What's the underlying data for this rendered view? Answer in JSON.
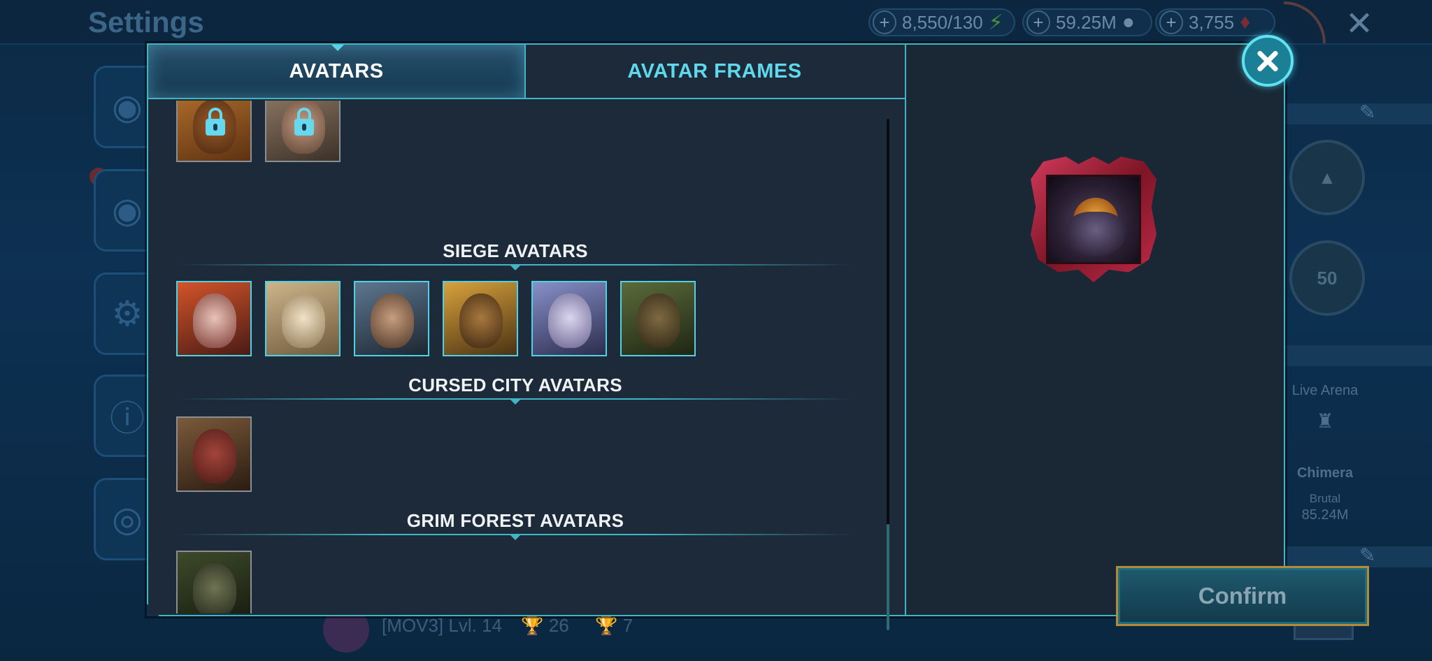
{
  "background": {
    "title": "Settings",
    "resources": [
      {
        "value": "8,550/130",
        "icon": "energy-icon"
      },
      {
        "value": "59.25M",
        "icon": "silver-icon"
      },
      {
        "value": "3,755",
        "icon": "gem-icon"
      }
    ],
    "right_panel": {
      "live_arena_label": "Live Arena",
      "clan_boss_name": "Chimera",
      "difficulty": "Brutal",
      "damage": "85.24M",
      "level_badge": "50"
    },
    "player": {
      "clan_tag": "[MOV3] Lvl. 14",
      "stat_1": "26",
      "stat_2": "7"
    }
  },
  "modal": {
    "tabs": [
      {
        "label": "AVATARS",
        "active": true
      },
      {
        "label": "AVATAR FRAMES",
        "active": false
      }
    ],
    "sections": [
      {
        "title": "SIEGE AVATARS"
      },
      {
        "title": "CURSED CITY AVATARS"
      },
      {
        "title": "GRIM FOREST AVATARS"
      }
    ],
    "confirm_label": "Confirm"
  },
  "colors": {
    "accent": "#3fb5c6",
    "tab_inactive_text": "#5fd8ec",
    "confirm_border": "#b58b3a",
    "close_button": "#1b7f96"
  }
}
